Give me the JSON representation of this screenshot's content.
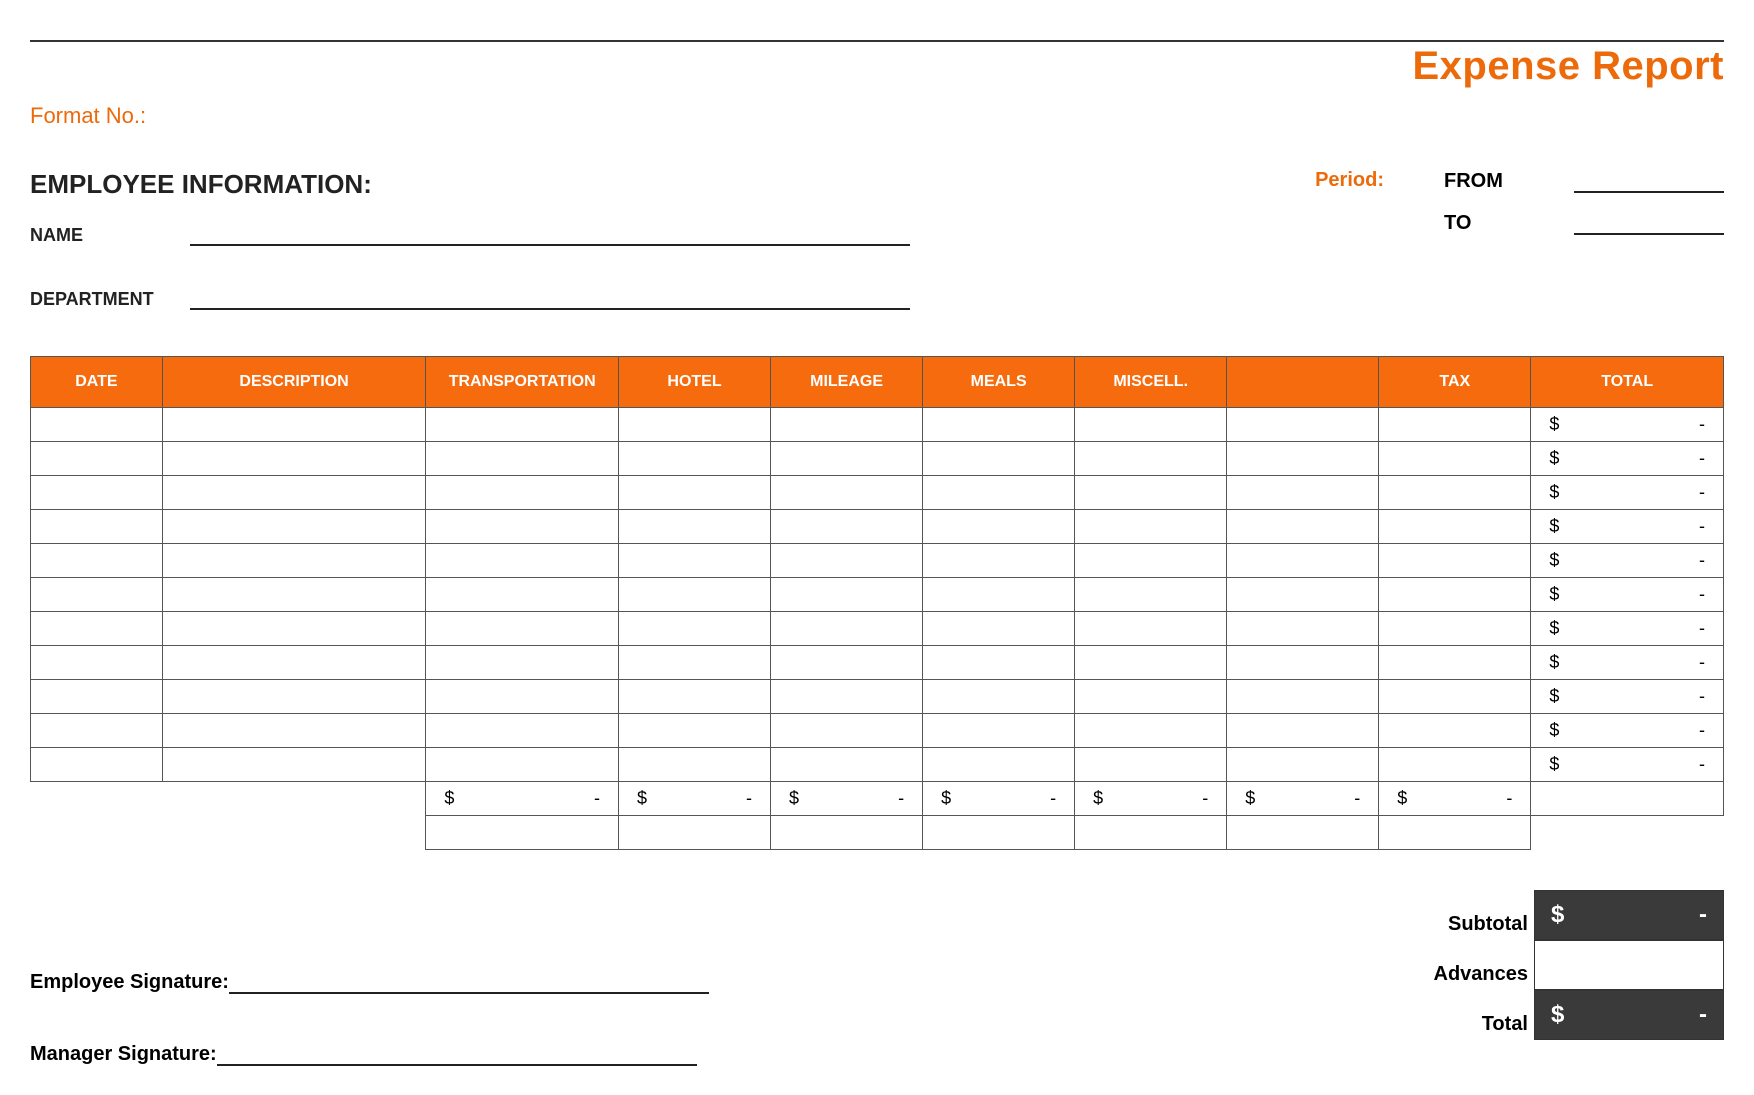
{
  "header": {
    "title": "Expense Report",
    "format_no_label": "Format No.:"
  },
  "employee_info": {
    "section_title": "EMPLOYEE INFORMATION:",
    "name_label": "NAME",
    "department_label": "DEPARTMENT"
  },
  "period": {
    "label": "Period:",
    "from_label": "FROM",
    "to_label": "TO"
  },
  "table": {
    "headers": {
      "date": "DATE",
      "description": "DESCRIPTION",
      "transportation": "TRANSPORTATION",
      "hotel": "HOTEL",
      "mileage": "MILEAGE",
      "meals": "MEALS",
      "miscell": "MISCELL.",
      "blank": "",
      "tax": "TAX",
      "total": "TOTAL"
    },
    "rows": [
      {
        "total_currency": "$",
        "total_value": "-"
      },
      {
        "total_currency": "$",
        "total_value": "-"
      },
      {
        "total_currency": "$",
        "total_value": "-"
      },
      {
        "total_currency": "$",
        "total_value": "-"
      },
      {
        "total_currency": "$",
        "total_value": "-"
      },
      {
        "total_currency": "$",
        "total_value": "-"
      },
      {
        "total_currency": "$",
        "total_value": "-"
      },
      {
        "total_currency": "$",
        "total_value": "-"
      },
      {
        "total_currency": "$",
        "total_value": "-"
      },
      {
        "total_currency": "$",
        "total_value": "-"
      },
      {
        "total_currency": "$",
        "total_value": "-"
      }
    ],
    "column_totals": {
      "transportation": {
        "currency": "$",
        "value": "-"
      },
      "hotel": {
        "currency": "$",
        "value": "-"
      },
      "mileage": {
        "currency": "$",
        "value": "-"
      },
      "meals": {
        "currency": "$",
        "value": "-"
      },
      "miscell": {
        "currency": "$",
        "value": "-"
      },
      "blank": {
        "currency": "$",
        "value": "-"
      },
      "tax": {
        "currency": "$",
        "value": "-"
      }
    }
  },
  "signatures": {
    "employee_label": "Employee Signature:",
    "manager_label": "Manager Signature:"
  },
  "totals": {
    "subtotal_label": "Subtotal",
    "subtotal": {
      "currency": "$",
      "value": "-"
    },
    "advances_label": "Advances",
    "total_label": "Total",
    "total": {
      "currency": "$",
      "value": "-"
    }
  }
}
